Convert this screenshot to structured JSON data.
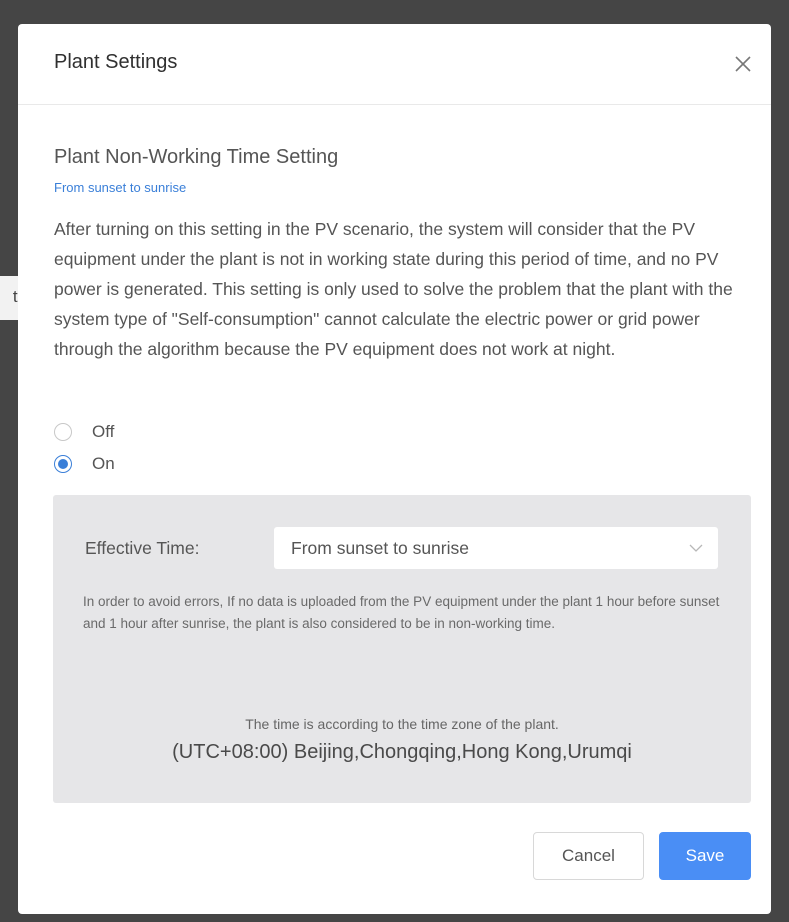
{
  "backdrop": {
    "partial_text": "th"
  },
  "dialog": {
    "title": "Plant Settings",
    "close_icon": "close-icon"
  },
  "section": {
    "title": "Plant Non-Working Time Setting",
    "subtitle": "From sunset to sunrise",
    "description": "After turning on this setting in the PV scenario, the system will consider that the PV equipment under the plant is not in working state during this period of time, and no PV power is generated. This setting is only used to solve the problem that the plant with the system type of \"Self-consumption\" cannot calculate the electric power or grid power through the algorithm because the PV equipment does not work at night."
  },
  "options": [
    {
      "label": "Off",
      "checked": false
    },
    {
      "label": "On",
      "checked": true
    }
  ],
  "effective_time": {
    "label": "Effective Time:",
    "selected": "From sunset to sunrise",
    "hint": "In order to avoid errors, If no data is uploaded from the PV equipment under the plant 1 hour before sunset and 1 hour after sunrise, the plant is also considered to be in non-working time.",
    "timezone_note": "The time is according to the time zone of the plant.",
    "timezone": "(UTC+08:00) Beijing,Chongqing,Hong Kong,Urumqi"
  },
  "footer": {
    "cancel_label": "Cancel",
    "save_label": "Save"
  },
  "colors": {
    "accent": "#3a7fd8",
    "save_button": "#4a8ef5",
    "panel_bg": "#e6e6e8",
    "overlay": "#454545"
  }
}
